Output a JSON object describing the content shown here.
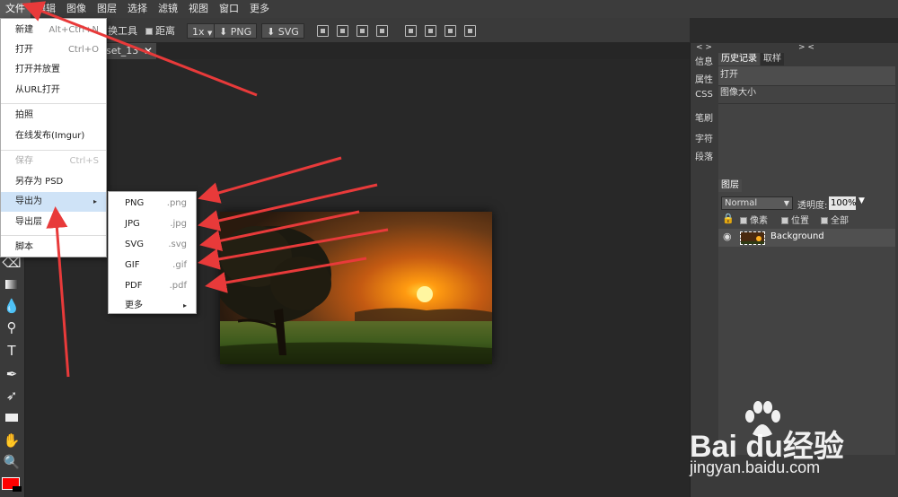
{
  "menubar": {
    "items": [
      "文件",
      "编辑",
      "图像",
      "图层",
      "选择",
      "滤镜",
      "视图",
      "窗口",
      "更多"
    ]
  },
  "options": {
    "partial_tool": "换工具",
    "distance_label": "距离",
    "zoom": "1x",
    "png_label": "PNG",
    "svg_label": "SVG"
  },
  "document_tab": {
    "label": "set_13",
    "close": "✕"
  },
  "file_menu": {
    "items": [
      {
        "label": "新建",
        "shortcut": "Alt+Ctrl+N"
      },
      {
        "label": "打开",
        "shortcut": "Ctrl+O"
      },
      {
        "label": "打开并放置",
        "shortcut": ""
      },
      {
        "label": "从URL打开",
        "shortcut": ""
      },
      {
        "label": "拍照",
        "shortcut": ""
      },
      {
        "label": "在线发布(Imgur)",
        "shortcut": ""
      },
      {
        "label": "保存",
        "shortcut": "Ctrl+S"
      },
      {
        "label": "另存为 PSD",
        "shortcut": ""
      },
      {
        "label": "导出为",
        "shortcut": "▸"
      },
      {
        "label": "导出层",
        "shortcut": ""
      },
      {
        "label": "脚本",
        "shortcut": ""
      }
    ]
  },
  "export_menu": {
    "items": [
      {
        "label": "PNG",
        "ext": ".png"
      },
      {
        "label": "JPG",
        "ext": ".jpg"
      },
      {
        "label": "SVG",
        "ext": ".svg"
      },
      {
        "label": "GIF",
        "ext": ".gif"
      },
      {
        "label": "PDF",
        "ext": ".pdf"
      },
      {
        "label": "更多",
        "ext": "▸"
      }
    ]
  },
  "side_panel": {
    "collapse_left": "< >",
    "collapse_right": "> <",
    "tabs": [
      "信息",
      "属性",
      "CSS",
      "笔刷",
      "字符",
      "段落"
    ]
  },
  "history_panel": {
    "tab_active": "历史记录",
    "tab_inactive": "取样",
    "entries": [
      "打开",
      "图像大小"
    ]
  },
  "layers_panel": {
    "title": "图层",
    "blend_mode": "Normal",
    "opacity_label": "透明度:",
    "opacity_value": "100%",
    "lock_pixels": "像素",
    "lock_position": "位置",
    "lock_all": "全部",
    "layer_name": "Background"
  },
  "watermark": {
    "main": "Bai du经验",
    "sub": "jingyan.baidu.com"
  },
  "colors": {
    "foreground": "#ff0000",
    "background": "#000000",
    "menu_highlight": "#cfe3f7",
    "annotation_arrow": "#e83a3a"
  }
}
